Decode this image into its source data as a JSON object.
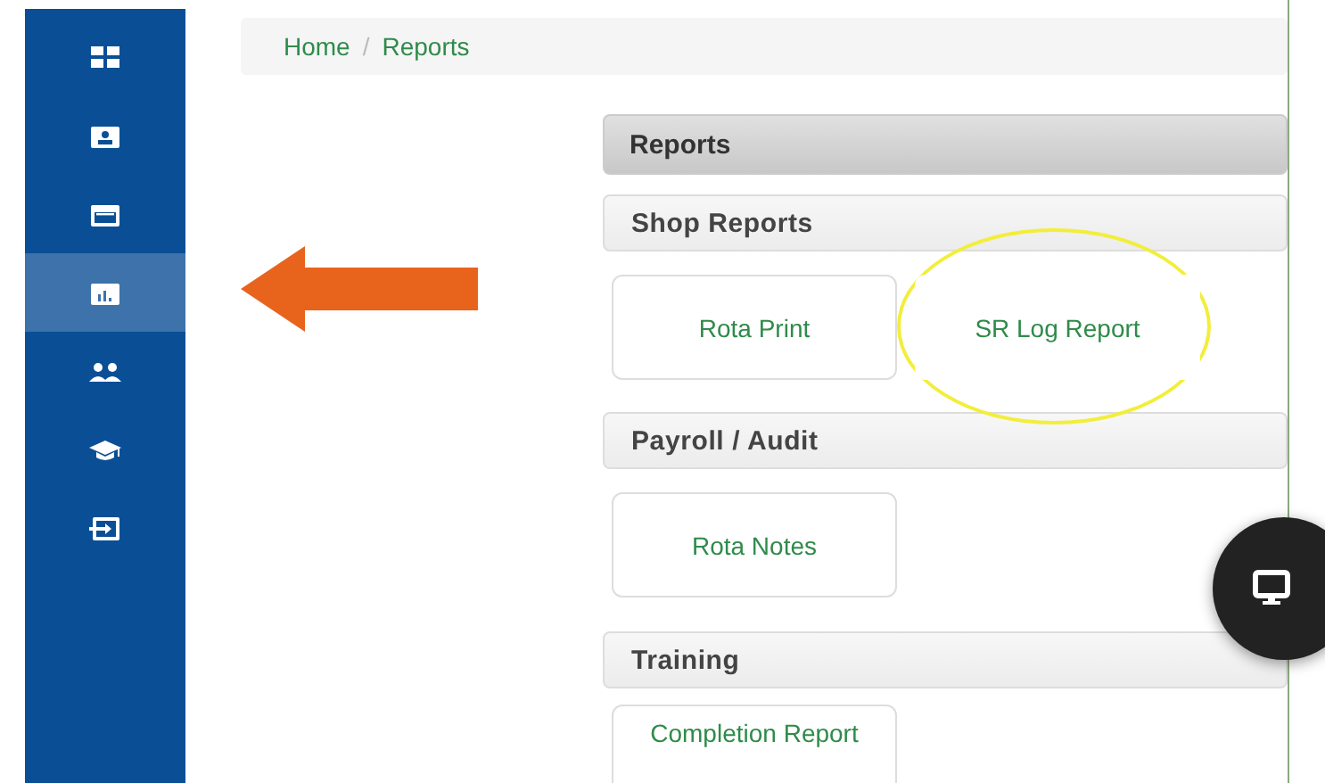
{
  "sidebar": {
    "items": [
      {
        "selected": false
      },
      {
        "selected": false
      },
      {
        "selected": false
      },
      {
        "selected": true
      },
      {
        "selected": false
      },
      {
        "selected": false
      },
      {
        "selected": false
      }
    ]
  },
  "breadcrumb": {
    "items": [
      {
        "label": "Home"
      },
      {
        "label": "Reports"
      }
    ],
    "separator": "/"
  },
  "reports": {
    "title": "Reports",
    "sections": [
      {
        "title": "Shop Reports",
        "links": [
          {
            "label": "Rota Print",
            "highlighted": false
          },
          {
            "label": "SR Log Report",
            "highlighted": true
          }
        ]
      },
      {
        "title": "Payroll / Audit",
        "links": [
          {
            "label": "Rota Notes",
            "highlighted": false
          }
        ]
      },
      {
        "title": "Training",
        "links": [
          {
            "label": "Completion Report",
            "highlighted": false
          }
        ]
      }
    ]
  }
}
